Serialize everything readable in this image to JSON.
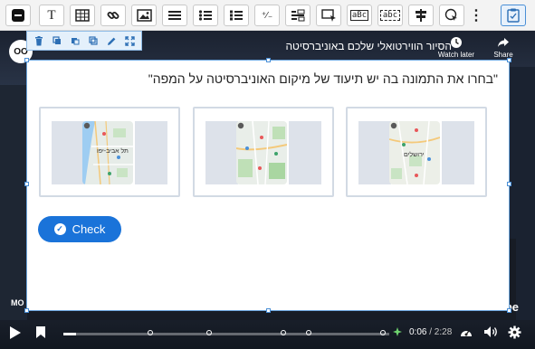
{
  "toolbar": {
    "tools": [
      {
        "name": "label-tool-icon",
        "glyph": ""
      },
      {
        "name": "text-tool-icon",
        "glyph": "T"
      },
      {
        "name": "table-tool-icon",
        "glyph": ""
      },
      {
        "name": "link-tool-icon",
        "glyph": ""
      },
      {
        "name": "image-tool-icon",
        "glyph": ""
      },
      {
        "name": "statements-tool-icon",
        "glyph": ""
      },
      {
        "name": "single-choice-tool-icon",
        "glyph": ""
      },
      {
        "name": "multiple-choice-tool-icon",
        "glyph": ""
      },
      {
        "name": "true-false-tool-icon",
        "glyph": "⁺⁄₋"
      },
      {
        "name": "fill-blanks-tool-icon",
        "glyph": ""
      },
      {
        "name": "drag-drop-tool-icon",
        "glyph": ""
      },
      {
        "name": "mark-words-tool-icon",
        "glyph": "aBc"
      },
      {
        "name": "drag-text-tool-icon",
        "glyph": "abc"
      },
      {
        "name": "crossroads-tool-icon",
        "glyph": ""
      },
      {
        "name": "navigation-hotspot-tool-icon",
        "glyph": ""
      },
      {
        "name": "more-tools-icon",
        "glyph": "⋮"
      },
      {
        "name": "summary-task-icon",
        "glyph": ""
      }
    ]
  },
  "video": {
    "logo": "OO",
    "title": "הסיור הווירטואלי שלכם באוניברסיטה",
    "watch_later": "Watch later",
    "share": "Share",
    "more_videos": "MO",
    "brand": "YouTube",
    "current_time": "0:06",
    "total_time": "/ 2:28",
    "progress": 0.04
  },
  "question": {
    "text": "\"בחרו את התמונה בה יש תיעוד של מיקום האוניברסיטה על המפה\"",
    "options": [
      {
        "label": "תל אביב-יפו"
      },
      {
        "label": ""
      },
      {
        "label": "ירושלים"
      }
    ],
    "check_label": "Check"
  },
  "colors": {
    "accent": "#1a73d9",
    "selection": "#4a8fd6"
  }
}
